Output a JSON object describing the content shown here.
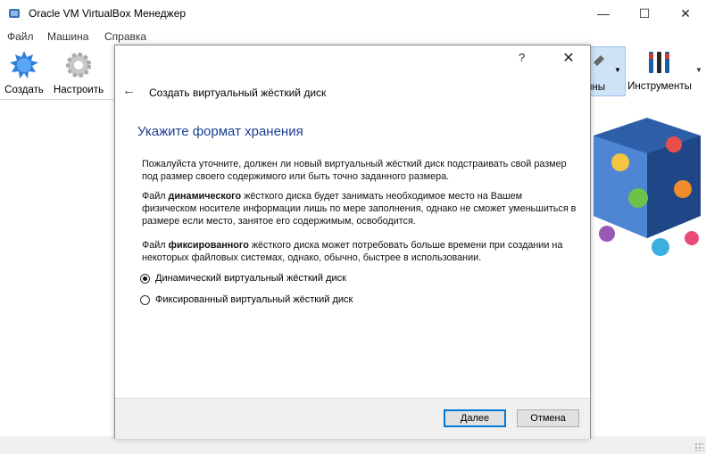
{
  "window": {
    "title": "Oracle VM VirtualBox Менеджер",
    "minimize_glyph": "—",
    "maximize_glyph": "☐",
    "close_glyph": "✕"
  },
  "menu": [
    "Файл",
    "Машина",
    "Справка"
  ],
  "toolbar": {
    "create_label": "Создать",
    "settings_label": "Настроить",
    "machines_label": "ины",
    "tools_label": "Инструменты"
  },
  "dialog": {
    "help_glyph": "?",
    "close_glyph": "✕",
    "back_glyph": "←",
    "wizard_title": "Создать виртуальный жёсткий диск",
    "heading": "Укажите формат хранения",
    "para1": "Пожалуйста уточните, должен ли новый виртуальный жёсткий диск подстраивать свой размер под размер своего содержимого или быть точно заданного размера.",
    "para2_prefix": "Файл ",
    "para2_bold": "динамического",
    "para2_rest": " жёсткого диска будет занимать необходимое место на Вашем физическом носителе информации лишь по мере заполнения, однако не сможет уменьшиться в размере если место, занятое его содержимым, освободится.",
    "para3_prefix": "Файл ",
    "para3_bold": "фиксированного",
    "para3_rest": " жёсткого диска может потребовать больше времени при создании на некоторых файловых системах, однако, обычно, быстрее в использовании.",
    "options": [
      {
        "label": "Динамический виртуальный жёсткий диск",
        "selected": true
      },
      {
        "label": "Фиксированный виртуальный жёсткий диск",
        "selected": false
      }
    ],
    "next_label": "Далее",
    "cancel_label": "Отмена"
  },
  "colors": {
    "heading": "#1c3f94",
    "default_button_border": "#0078d7",
    "selected_tool_bg": "#cfe3f7"
  }
}
